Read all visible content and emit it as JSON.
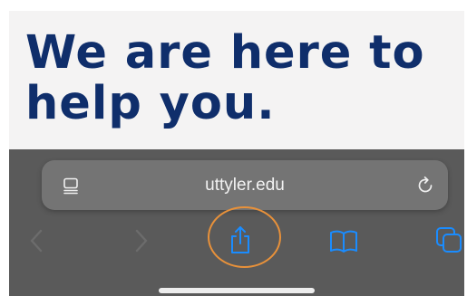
{
  "page": {
    "heading_line1": "We are here to",
    "heading_line2": "help you."
  },
  "address_bar": {
    "url": "uttyler.edu"
  },
  "toolbar": {
    "buttons": [
      "back",
      "forward",
      "share",
      "bookmarks",
      "tabs"
    ],
    "highlighted_button": "share"
  },
  "icons": {
    "page_menu": "page-menu-icon",
    "reload": "reload-icon",
    "back": "chevron-left-icon",
    "forward": "chevron-right-icon",
    "share": "share-icon",
    "bookmarks": "book-icon",
    "tabs": "tabs-icon"
  },
  "colors": {
    "heading": "#0f2e6b",
    "accent": "#1a8cff",
    "highlight_circle": "#e8913a",
    "toolbar_bg": "#5a5a5a",
    "address_bar_bg": "#747474"
  }
}
